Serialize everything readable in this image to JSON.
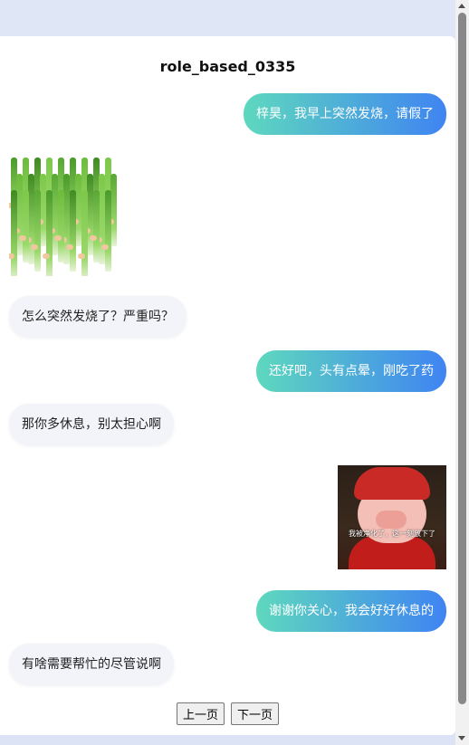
{
  "chat": {
    "title": "role_based_0335",
    "messages": [
      {
        "side": "sent",
        "text": "梓昊，我早上突然发烧，请假了"
      },
      {
        "side": "recv",
        "sticker": "green-onion-sticker"
      },
      {
        "side": "recv",
        "text": "怎么突然发烧了？严重吗？"
      },
      {
        "side": "sent",
        "text": "还好吧，头有点晕，刚吃了药"
      },
      {
        "side": "recv",
        "text": "那你多休息，别太担心啊"
      },
      {
        "side": "sent",
        "sticker": "pig-sticker",
        "caption": "我被净化了，这一刻放下了"
      },
      {
        "side": "sent",
        "text": "谢谢你关心，我会好好休息的"
      },
      {
        "side": "recv",
        "text": "有啥需要帮忙的尽管说啊"
      }
    ]
  },
  "pager": {
    "prev_label": "上一页",
    "next_label": "下一页"
  },
  "colors": {
    "sent_gradient_start": "#5ed8be",
    "sent_gradient_end": "#3f84f2",
    "recv_bubble": "#f2f4f9"
  }
}
